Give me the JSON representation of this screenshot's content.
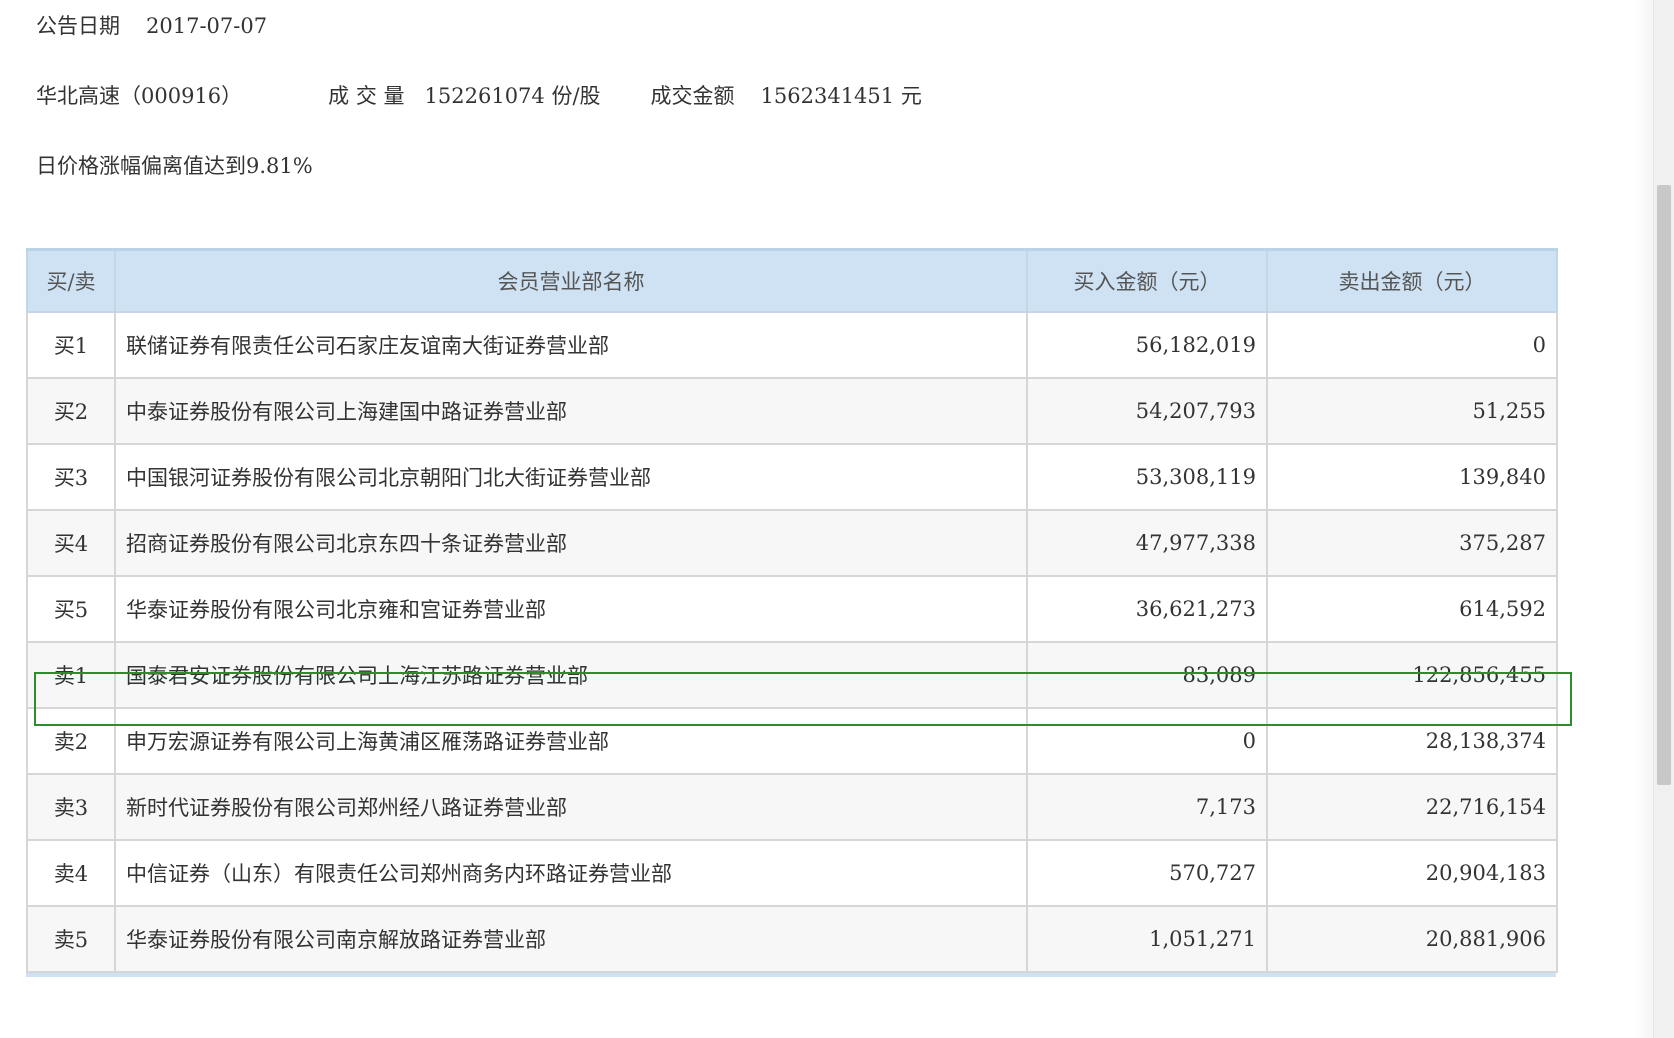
{
  "announcement": {
    "date_label": "公告日期",
    "date_value": "2017-07-07"
  },
  "stock": {
    "name_code": "华北高速（000916）",
    "volume_label": "成 交 量",
    "volume_value": "152261074 份/股",
    "amount_label": "成交金额",
    "amount_value": "1562341451 元"
  },
  "reason": "日价格涨幅偏离值达到9.81%",
  "table": {
    "headers": {
      "side": "买/卖",
      "name": "会员营业部名称",
      "buy": "买入金额（元）",
      "sell": "卖出金额（元）"
    },
    "rows": [
      {
        "side": "买1",
        "name": "联储证券有限责任公司石家庄友谊南大街证券营业部",
        "buy": "56,182,019",
        "sell": "0"
      },
      {
        "side": "买2",
        "name": "中泰证券股份有限公司上海建国中路证券营业部",
        "buy": "54,207,793",
        "sell": "51,255"
      },
      {
        "side": "买3",
        "name": "中国银河证券股份有限公司北京朝阳门北大街证券营业部",
        "buy": "53,308,119",
        "sell": "139,840"
      },
      {
        "side": "买4",
        "name": "招商证券股份有限公司北京东四十条证券营业部",
        "buy": "47,977,338",
        "sell": "375,287"
      },
      {
        "side": "买5",
        "name": "华泰证券股份有限公司北京雍和宫证券营业部",
        "buy": "36,621,273",
        "sell": "614,592"
      },
      {
        "side": "卖1",
        "name": "国泰君安证券股份有限公司上海江苏路证券营业部",
        "buy": "83,089",
        "sell": "122,856,455"
      },
      {
        "side": "卖2",
        "name": "申万宏源证券有限公司上海黄浦区雁荡路证券营业部",
        "buy": "0",
        "sell": "28,138,374"
      },
      {
        "side": "卖3",
        "name": "新时代证券股份有限公司郑州经八路证券营业部",
        "buy": "7,173",
        "sell": "22,716,154"
      },
      {
        "side": "卖4",
        "name": "中信证券（山东）有限责任公司郑州商务内环路证券营业部",
        "buy": "570,727",
        "sell": "20,904,183"
      },
      {
        "side": "卖5",
        "name": "华泰证券股份有限公司南京解放路证券营业部",
        "buy": "1,051,271",
        "sell": "20,881,906"
      }
    ]
  },
  "colors": {
    "header_bg": "#cfe2f3",
    "highlight_border": "#2e8b2e"
  }
}
